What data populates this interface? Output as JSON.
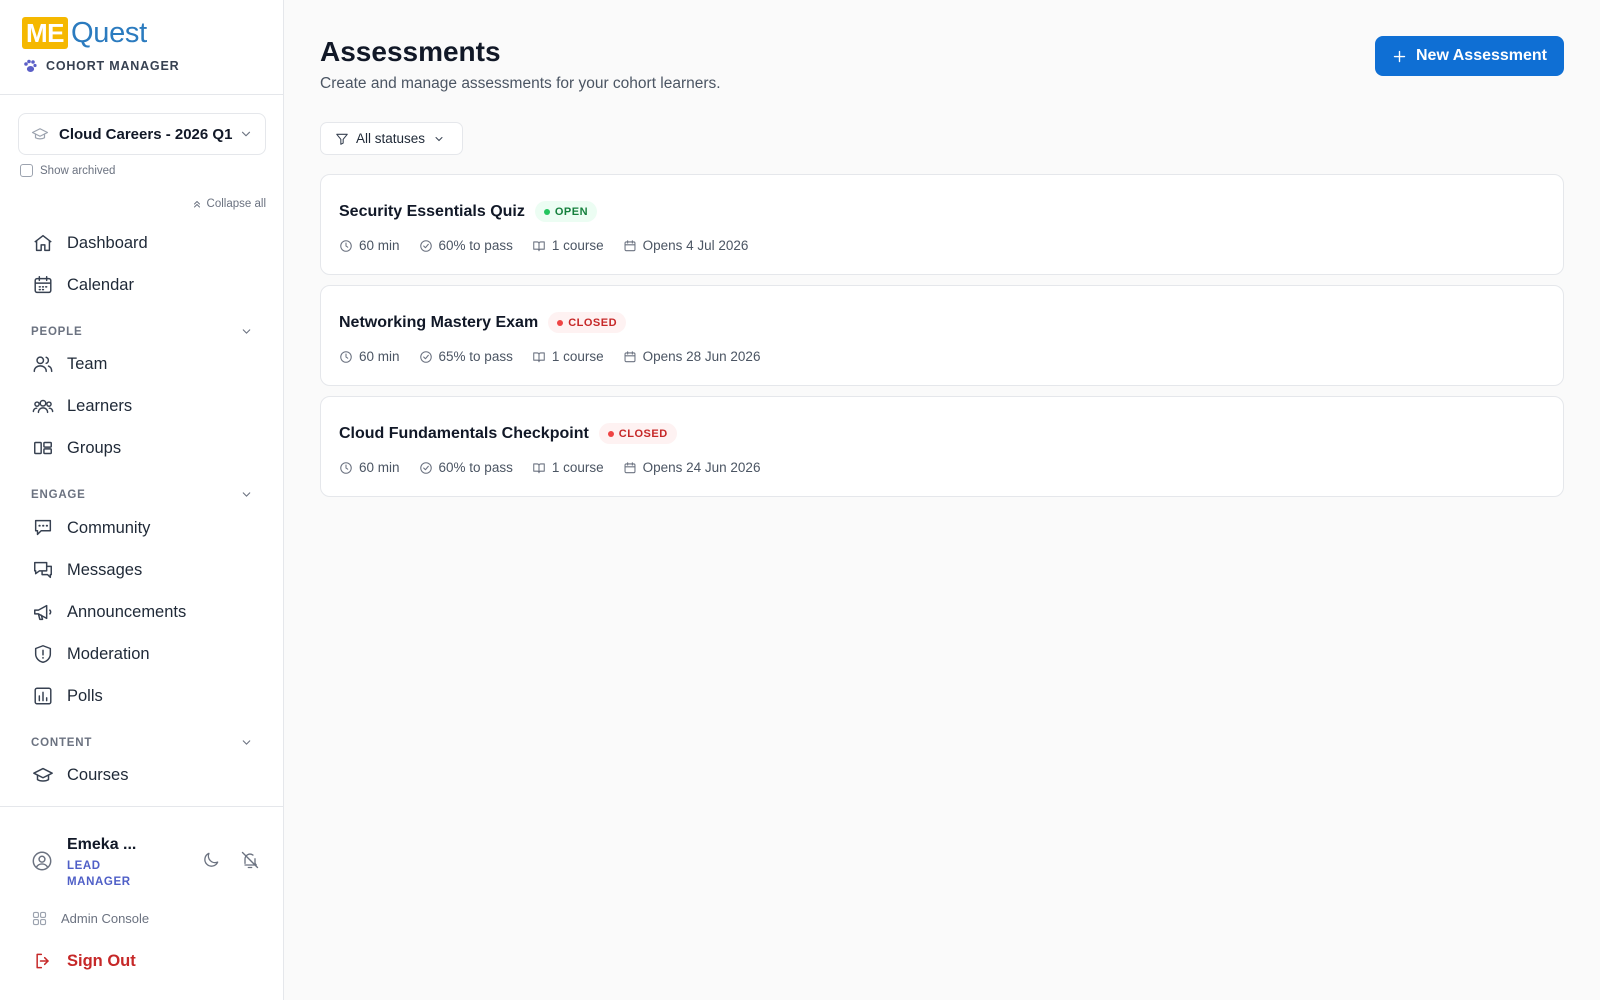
{
  "brand": {
    "logo_me": "ME",
    "logo_quest": "Quest",
    "subtitle": "COHORT MANAGER"
  },
  "sidebar": {
    "cohort": "Cloud Careers - 2026 Q1",
    "show_archived": "Show archived",
    "collapse_all": "Collapse all",
    "top_items": [
      {
        "label": "Dashboard",
        "icon": "home-icon"
      },
      {
        "label": "Calendar",
        "icon": "calendar-icon"
      }
    ],
    "sections": [
      {
        "title": "PEOPLE",
        "items": [
          {
            "label": "Team",
            "icon": "users-icon"
          },
          {
            "label": "Learners",
            "icon": "user-group-icon"
          },
          {
            "label": "Groups",
            "icon": "groups-icon"
          }
        ]
      },
      {
        "title": "ENGAGE",
        "items": [
          {
            "label": "Community",
            "icon": "community-icon"
          },
          {
            "label": "Messages",
            "icon": "messages-icon"
          },
          {
            "label": "Announcements",
            "icon": "megaphone-icon"
          },
          {
            "label": "Moderation",
            "icon": "shield-icon"
          },
          {
            "label": "Polls",
            "icon": "poll-icon"
          }
        ]
      },
      {
        "title": "CONTENT",
        "items": [
          {
            "label": "Courses",
            "icon": "graduation-cap-icon"
          }
        ]
      }
    ],
    "user": {
      "name": "Emeka ...",
      "role_line1": "LEAD",
      "role_line2": "MANAGER"
    },
    "admin_console": "Admin Console",
    "sign_out": "Sign Out"
  },
  "main": {
    "title": "Assessments",
    "subtitle": "Create and manage assessments for your cohort learners.",
    "new_button": "New Assessment",
    "filter_label": "All statuses",
    "assessments": [
      {
        "title": "Security Essentials Quiz",
        "status": "OPEN",
        "duration": "60 min",
        "pass": "60% to pass",
        "courses": "1 course",
        "opens": "Opens 4 Jul 2026"
      },
      {
        "title": "Networking Mastery Exam",
        "status": "CLOSED",
        "duration": "60 min",
        "pass": "65% to pass",
        "courses": "1 course",
        "opens": "Opens 28 Jun 2026"
      },
      {
        "title": "Cloud Fundamentals Checkpoint",
        "status": "CLOSED",
        "duration": "60 min",
        "pass": "60% to pass",
        "courses": "1 course",
        "opens": "Opens 24 Jun 2026"
      }
    ]
  },
  "colors": {
    "accent": "#0f6fd4",
    "logo_yellow": "#f5b800",
    "open_green": "#15803d",
    "closed_red": "#c62828",
    "role_purple": "#4f5fc7"
  }
}
